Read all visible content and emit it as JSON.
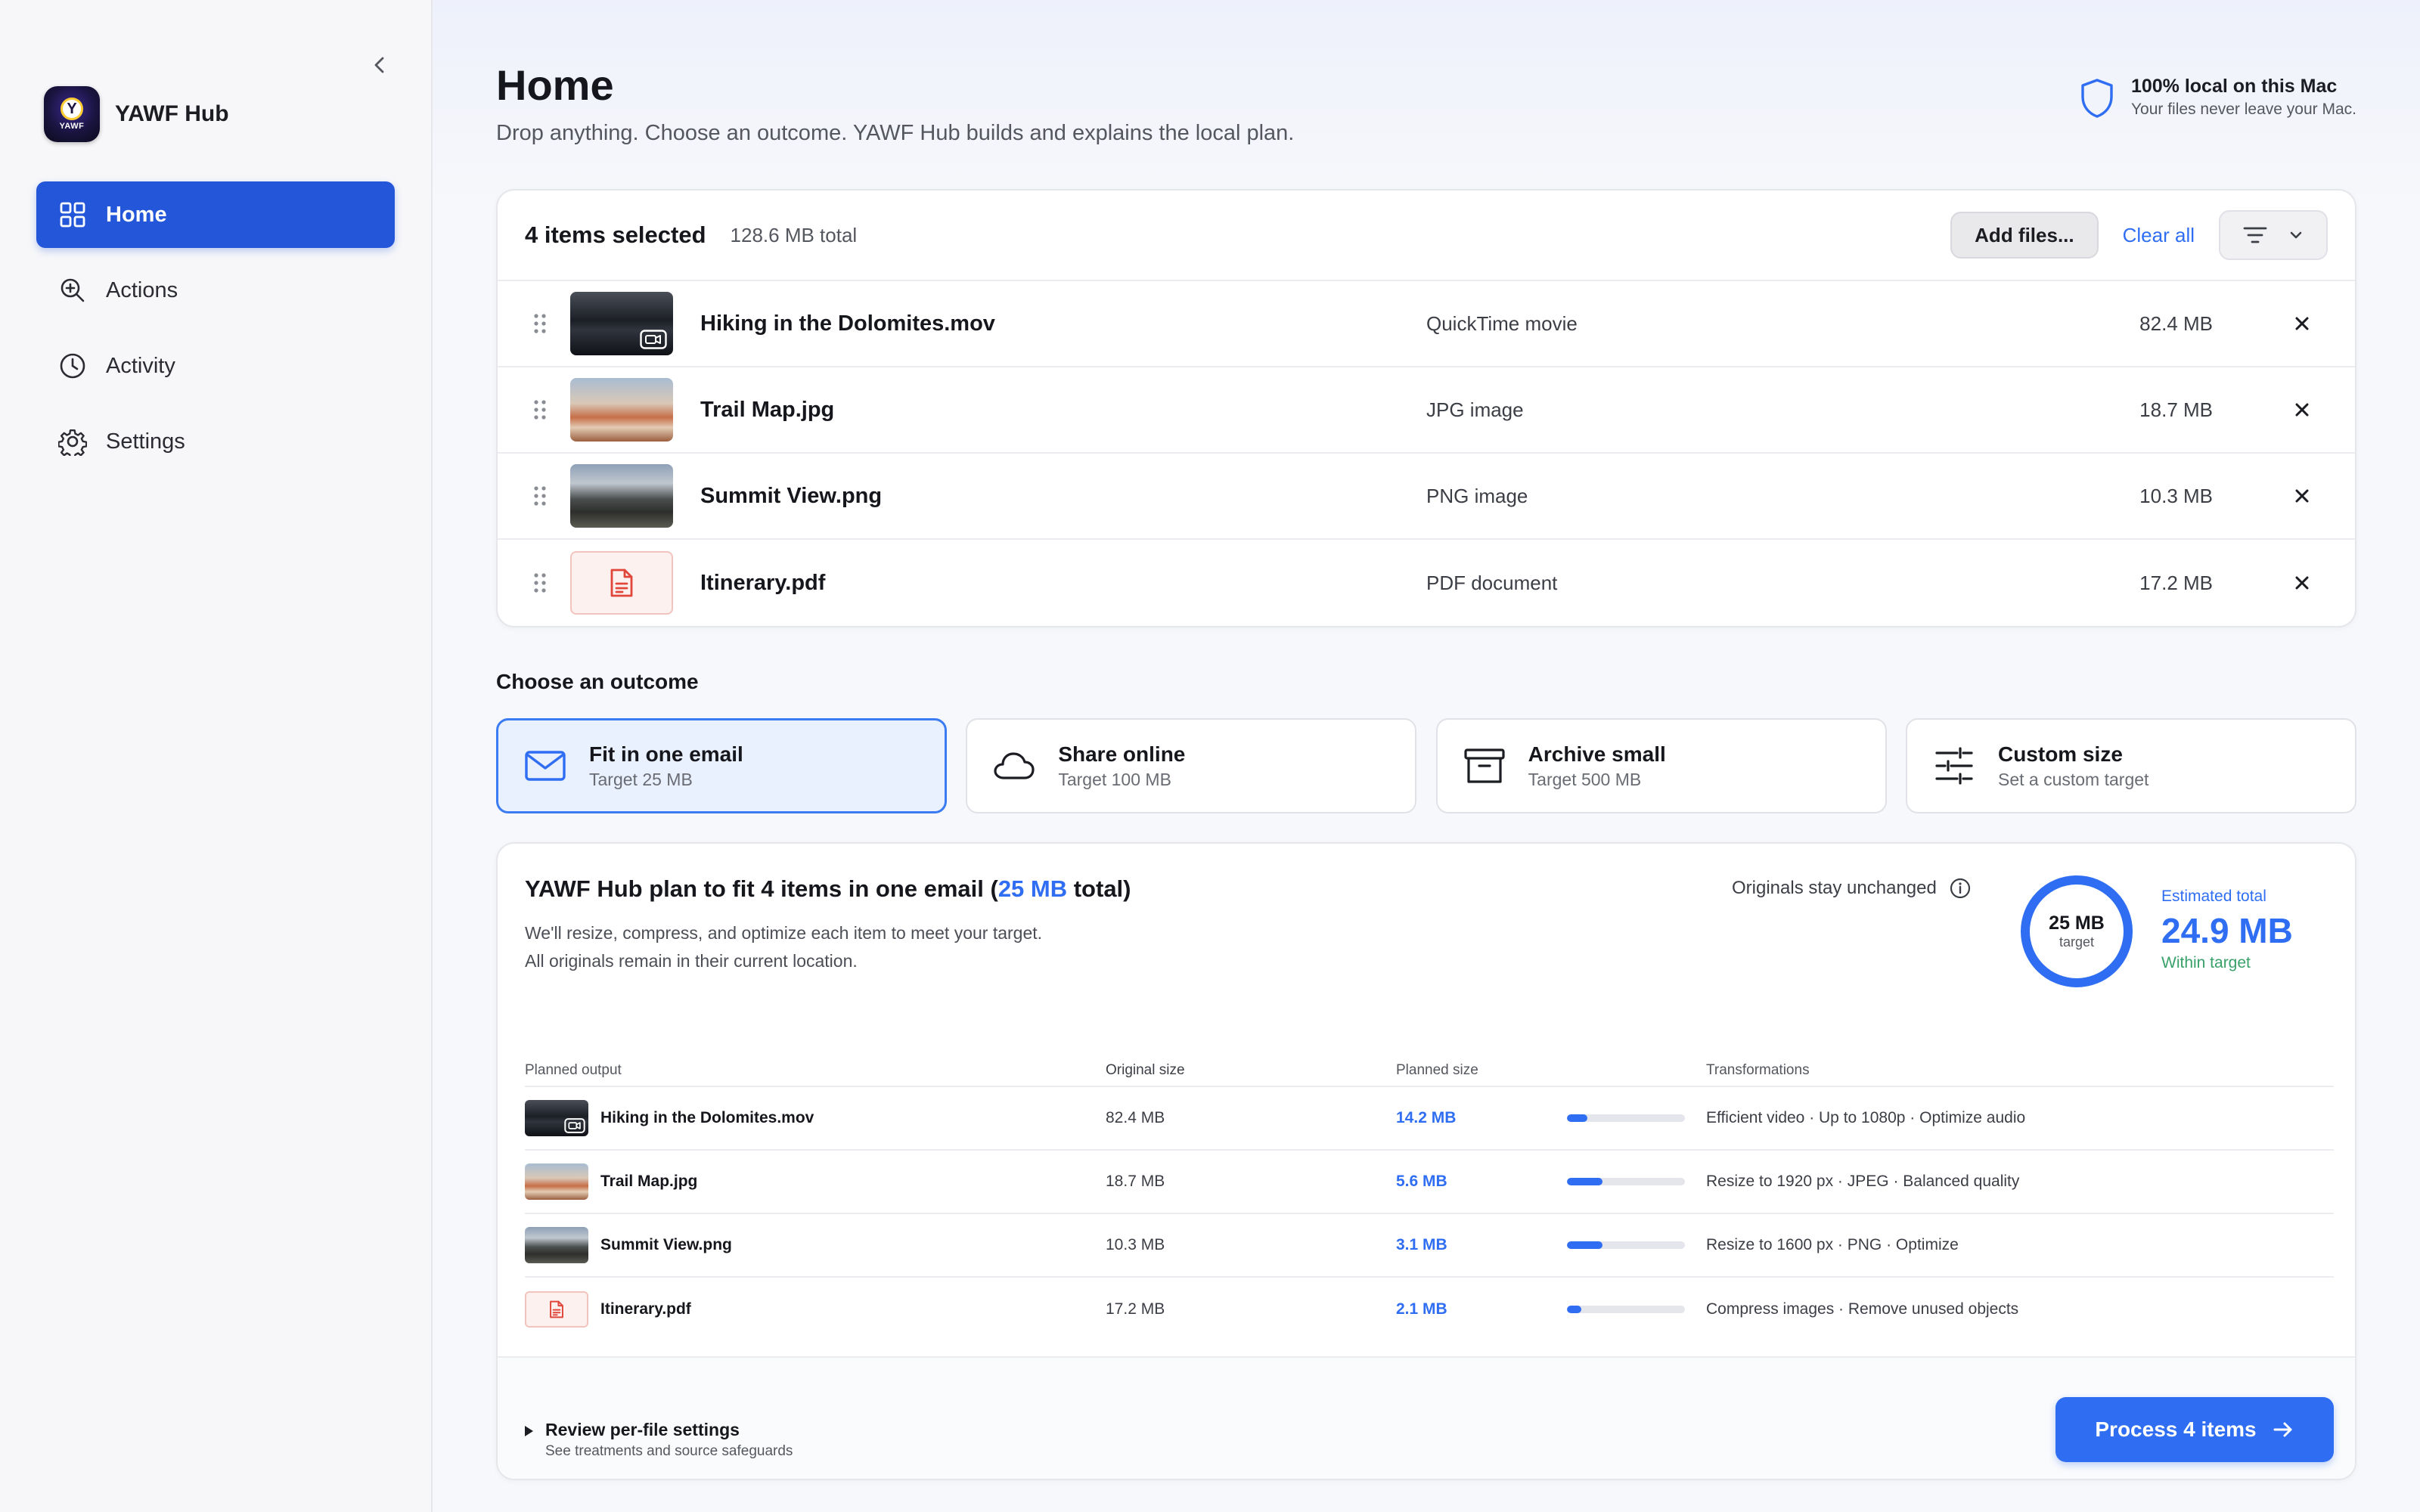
{
  "sidebar": {
    "app_name": "YAWF Hub",
    "app_icon_letter": "Y",
    "app_icon_text": "YAWF",
    "items": [
      {
        "label": "Home",
        "icon": "grid-icon",
        "active": true
      },
      {
        "label": "Actions",
        "icon": "zoom-in-icon",
        "active": false
      },
      {
        "label": "Activity",
        "icon": "clock-icon",
        "active": false
      },
      {
        "label": "Settings",
        "icon": "gear-icon",
        "active": false
      }
    ]
  },
  "header": {
    "title": "Home",
    "subtitle": "Drop anything. Choose an outcome. YAWF Hub builds and explains the local plan.",
    "privacy_title": "100% local on this Mac",
    "privacy_sub": "Your files never leave your Mac."
  },
  "files": {
    "count_label": "4 items selected",
    "total_label": "128.6 MB total",
    "add_label": "Add files...",
    "clear_label": "Clear all",
    "items": [
      {
        "name": "Hiking in the Dolomites.mov",
        "type": "QuickTime movie",
        "size": "82.4 MB",
        "thumb": "mov"
      },
      {
        "name": "Trail Map.jpg",
        "type": "JPG image",
        "size": "18.7 MB",
        "thumb": "jpg"
      },
      {
        "name": "Summit View.png",
        "type": "PNG image",
        "size": "10.3 MB",
        "thumb": "png"
      },
      {
        "name": "Itinerary.pdf",
        "type": "PDF document",
        "size": "17.2 MB",
        "thumb": "pdf"
      }
    ]
  },
  "outcomes": {
    "label": "Choose an outcome",
    "options": [
      {
        "title": "Fit in one email",
        "sub": "Target 25 MB",
        "icon": "envelope-icon",
        "selected": true
      },
      {
        "title": "Share online",
        "sub": "Target 100 MB",
        "icon": "cloud-icon",
        "selected": false
      },
      {
        "title": "Archive small",
        "sub": "Target 500 MB",
        "icon": "archive-box-icon",
        "selected": false
      },
      {
        "title": "Custom size",
        "sub": "Set a custom target",
        "icon": "sliders-icon",
        "selected": false
      }
    ]
  },
  "plan": {
    "title_pre": "YAWF Hub plan to fit 4 items in one email (",
    "title_accent": "25 MB",
    "title_post": " total)",
    "desc_line1": "We'll resize, compress, and optimize each item to meet your target.",
    "desc_line2": "All originals remain in their current location.",
    "originals_label": "Originals stay unchanged",
    "gauge_value": "25 MB",
    "gauge_label": "target",
    "estimated_label": "Estimated total",
    "estimated_value": "24.9 MB",
    "within_label": "Within target",
    "columns": [
      "Planned output",
      "Original size",
      "Planned size",
      "Transformations"
    ],
    "rows": [
      {
        "name": "Hiking in the Dolomites.mov",
        "original": "82.4 MB",
        "planned": "14.2 MB",
        "ratio": 0.17,
        "transform": "Efficient video · Up to 1080p · Optimize audio",
        "thumb": "mov"
      },
      {
        "name": "Trail Map.jpg",
        "original": "18.7 MB",
        "planned": "5.6 MB",
        "ratio": 0.3,
        "transform": "Resize to 1920 px · JPEG · Balanced quality",
        "thumb": "jpg"
      },
      {
        "name": "Summit View.png",
        "original": "10.3 MB",
        "planned": "3.1 MB",
        "ratio": 0.3,
        "transform": "Resize to 1600 px · PNG · Optimize",
        "thumb": "png"
      },
      {
        "name": "Itinerary.pdf",
        "original": "17.2 MB",
        "planned": "2.1 MB",
        "ratio": 0.12,
        "transform": "Compress images · Remove unused objects",
        "thumb": "pdf"
      }
    ],
    "review_title": "Review per-file settings",
    "review_sub": "See treatments and source safeguards",
    "process_label": "Process 4 items"
  },
  "colors": {
    "accent": "#2f6ef2",
    "nav_active": "#2356d9",
    "success": "#38a169",
    "pdf_red": "#e0473a"
  }
}
